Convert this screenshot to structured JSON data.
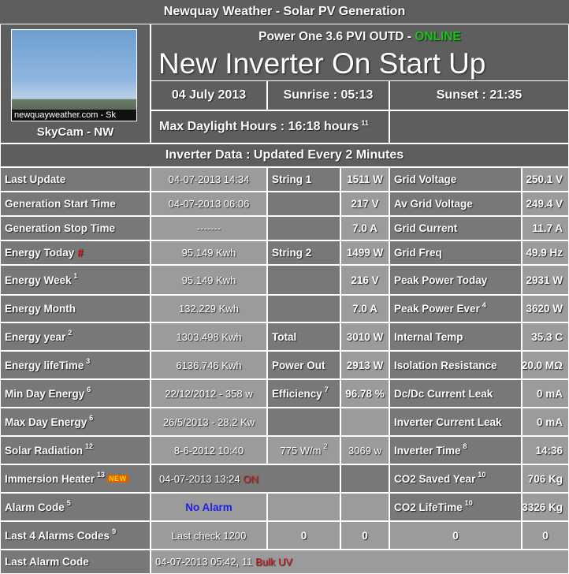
{
  "page": {
    "title": "Newquay Weather - Solar PV Generation",
    "inverter_model": "Power One 3.6 PVI OUTD -",
    "inverter_status": "ONLINE",
    "message": "New Inverter On Start Up",
    "date": "04 July 2013",
    "sunrise": "Sunrise : 05:13",
    "sunset": "Sunset : 21:35",
    "max_daylight": "Max Daylight Hours : 16:18 hours",
    "max_daylight_note": "11",
    "skycam_caption": "newquayweather.com - Sk",
    "skycam_label": "SkyCam - NW",
    "section_header": "Inverter Data : Updated Every 2 Minutes"
  },
  "rows": {
    "r1": {
      "label": "Last Update",
      "value": "04-07-2013 14:34",
      "s_label": "String 1",
      "s_val": "1511 W",
      "g_label": "Grid Voltage",
      "g_val": "250.1 V"
    },
    "r2": {
      "label": "Generation Start Time",
      "value": "04-07-2013 06:06",
      "s_val": "217 V",
      "g_label": "Av Grid Voltage",
      "g_val": "249.4 V"
    },
    "r3": {
      "label": "Generation Stop Time",
      "value": "-------",
      "s_val": "7.0 A",
      "g_label": "Grid Current",
      "g_val": "11.7 A"
    },
    "r4": {
      "label": "Energy Today",
      "mark": "#",
      "value": "95.149 Kwh",
      "s_label": "String 2",
      "s_val": "1499 W",
      "g_label": "Grid Freq",
      "g_val": "49.9 Hz"
    },
    "r5": {
      "label": "Energy Week",
      "note": "1",
      "value": "95.149 Kwh",
      "s_val": "216 V",
      "g_label": "Peak Power Today",
      "g_val": "2931 W"
    },
    "r6": {
      "label": "Energy Month",
      "value": "132.229 Kwh",
      "s_val": "7.0 A",
      "g_label": "Peak Power Ever",
      "g_note": "4",
      "g_val": "3620 W"
    },
    "r7": {
      "label": "Energy year",
      "note": "2",
      "value": "1303.498 Kwh",
      "s_label": "Total",
      "s_val": "3010 W",
      "g_label": "Internal Temp",
      "g_val": "35.3 C"
    },
    "r8": {
      "label": "Energy lifeTime",
      "note": "3",
      "value": "6136.746 Kwh",
      "s_label": "Power Out",
      "s_val": "2913 W",
      "g_label": "Isolation Resistance",
      "g_val": "20.0 MΩ"
    },
    "r9": {
      "label": "Min Day Energy",
      "note": "6",
      "value": "22/12/2012 - 358 w",
      "s_label": "Efficiency",
      "s_note": "7",
      "s_val": "96.78 %",
      "g_label": "Dc/Dc Current Leak",
      "g_val": "0 mA"
    },
    "r10": {
      "label": "Max Day Energy",
      "note": "6",
      "value": "26/5/2013 - 28.2 Kw",
      "g_label": "Inverter Current Leak",
      "g_val": "0 mA"
    },
    "r11": {
      "label": "Solar Radiation",
      "note": "12",
      "value": "8-6-2012 10:40",
      "s_label": "775 W/m",
      "s_sup": "2",
      "s_val": "3069 w",
      "g_label": "Inverter Time",
      "g_note": "8",
      "g_val": "14:36"
    },
    "r12": {
      "label": "Immersion Heater",
      "note": "13",
      "badge": "NEW",
      "value": "04-07-2013 13:24",
      "value_status": "ON",
      "g_label": "CO2 Saved Year",
      "g_note": "10",
      "g_val": "706 Kg"
    },
    "r13": {
      "label": "Alarm Code",
      "note": "5",
      "value": "No Alarm",
      "g_label": "CO2 LifeTime",
      "g_note": "10",
      "g_val": "3326 Kg"
    },
    "r14": {
      "label": "Last 4 Alarms Codes",
      "note": "9",
      "value": "Last check 1200",
      "a1": "0",
      "a2": "0",
      "a3": "0",
      "a4": "0"
    },
    "r15": {
      "label": "Last Alarm Code",
      "value": "04-07-2013 05:42, 11",
      "value_status": "Bulk UV"
    }
  },
  "colors": {
    "online": "#18c418",
    "alert": "#e02020",
    "no_alarm": "#2020e0"
  }
}
